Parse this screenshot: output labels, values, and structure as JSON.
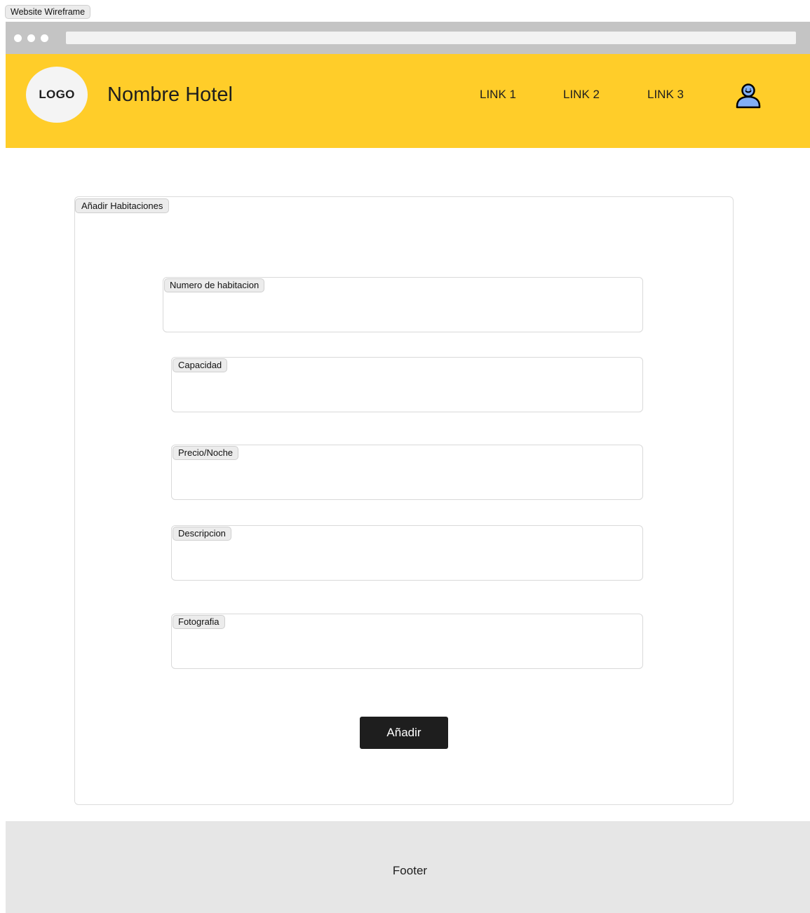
{
  "frame": {
    "title": "Website Wireframe"
  },
  "header": {
    "logo_text": "LOGO",
    "hotel_name": "Nombre Hotel",
    "nav": [
      {
        "label": "LINK 1"
      },
      {
        "label": "LINK 2"
      },
      {
        "label": "LINK 3"
      }
    ],
    "user_icon": "user-profile-icon"
  },
  "form": {
    "section_title": "Añadir Habitaciones",
    "fields": [
      {
        "label": "Numero de habitacion",
        "value": ""
      },
      {
        "label": "Capacidad",
        "value": ""
      },
      {
        "label": "Precio/Noche",
        "value": ""
      },
      {
        "label": "Descripcion",
        "value": ""
      },
      {
        "label": "Fotografia",
        "value": ""
      }
    ],
    "submit_label": "Añadir"
  },
  "footer": {
    "text": "Footer"
  },
  "colors": {
    "header_bg": "#ffcd29",
    "button_bg": "#1e1e1e",
    "footer_bg": "#e6e6e6",
    "browser_bar": "#c4c4c4",
    "user_icon_fill": "#82aff5"
  }
}
